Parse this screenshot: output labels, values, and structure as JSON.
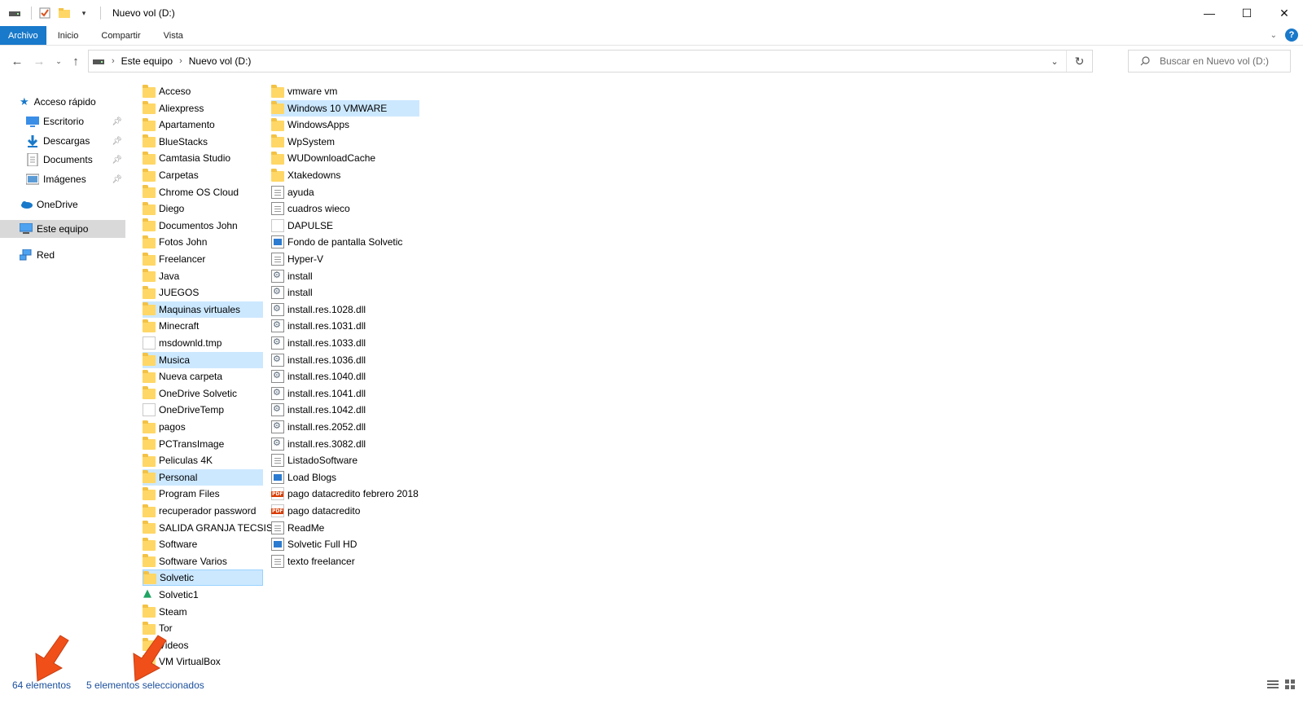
{
  "window": {
    "title": "Nuevo vol (D:)",
    "controls": {
      "minimize": "—",
      "maximize": "☐",
      "close": "✕"
    }
  },
  "ribbon": {
    "tabs": [
      "Archivo",
      "Inicio",
      "Compartir",
      "Vista"
    ],
    "help": "?"
  },
  "address": {
    "crumbs": [
      "Este equipo",
      "Nuevo vol (D:)"
    ],
    "search_placeholder": "Buscar en Nuevo vol (D:)"
  },
  "nav": {
    "quick_access": "Acceso rápido",
    "items": [
      {
        "label": "Escritorio",
        "icon": "desktop-icon",
        "pinned": true
      },
      {
        "label": "Descargas",
        "icon": "download-icon",
        "pinned": true
      },
      {
        "label": "Documents",
        "icon": "documents-icon",
        "pinned": true
      },
      {
        "label": "Imágenes",
        "icon": "pictures-icon",
        "pinned": true
      }
    ],
    "onedrive": "OneDrive",
    "this_pc": "Este equipo",
    "network": "Red"
  },
  "files": {
    "col1": [
      {
        "name": "Acceso",
        "type": "folder"
      },
      {
        "name": "Aliexpress",
        "type": "folder"
      },
      {
        "name": "Apartamento",
        "type": "folder"
      },
      {
        "name": "BlueStacks",
        "type": "folder"
      },
      {
        "name": "Camtasia Studio",
        "type": "folder"
      },
      {
        "name": "Carpetas",
        "type": "folder"
      },
      {
        "name": "Chrome OS Cloud",
        "type": "folder"
      },
      {
        "name": "Diego",
        "type": "folder"
      },
      {
        "name": "Documentos John",
        "type": "folder"
      },
      {
        "name": "Fotos John",
        "type": "folder"
      },
      {
        "name": "Freelancer",
        "type": "folder"
      },
      {
        "name": "Java",
        "type": "folder"
      },
      {
        "name": "JUEGOS",
        "type": "folder"
      },
      {
        "name": "Maquinas virtuales",
        "type": "folder",
        "selected": true
      },
      {
        "name": "Minecraft",
        "type": "folder"
      },
      {
        "name": "msdownld.tmp",
        "type": "blank"
      },
      {
        "name": "Musica",
        "type": "folder",
        "selected": true
      },
      {
        "name": "Nueva carpeta",
        "type": "folder"
      },
      {
        "name": "OneDrive Solvetic",
        "type": "folder"
      },
      {
        "name": "OneDriveTemp",
        "type": "blank"
      },
      {
        "name": "pagos",
        "type": "folder"
      },
      {
        "name": "PCTransImage",
        "type": "folder"
      },
      {
        "name": "Peliculas 4K",
        "type": "folder"
      },
      {
        "name": "Personal",
        "type": "folder",
        "selected": true
      },
      {
        "name": "Program Files",
        "type": "folder"
      },
      {
        "name": "recuperador password",
        "type": "folder"
      },
      {
        "name": "SALIDA GRANJA TECSIS",
        "type": "folder"
      },
      {
        "name": "Software",
        "type": "folder"
      },
      {
        "name": "Software Varios",
        "type": "folder"
      },
      {
        "name": "Solvetic",
        "type": "folder",
        "selected": true,
        "focused": true
      },
      {
        "name": "Solvetic1",
        "type": "gdrive"
      },
      {
        "name": "Steam",
        "type": "folder"
      },
      {
        "name": "Tor",
        "type": "folder"
      },
      {
        "name": "Videos",
        "type": "folder"
      },
      {
        "name": "VM VirtualBox",
        "type": "folder"
      }
    ],
    "col2": [
      {
        "name": "vmware vm",
        "type": "folder"
      },
      {
        "name": "Windows 10 VMWARE",
        "type": "folder",
        "selected": true
      },
      {
        "name": "WindowsApps",
        "type": "folder"
      },
      {
        "name": "WpSystem",
        "type": "folder"
      },
      {
        "name": "WUDownloadCache",
        "type": "folder"
      },
      {
        "name": "Xtakedowns",
        "type": "folder"
      },
      {
        "name": "ayuda",
        "type": "doc"
      },
      {
        "name": "cuadros wieco",
        "type": "doc"
      },
      {
        "name": "DAPULSE",
        "type": "blank"
      },
      {
        "name": "Fondo de pantalla Solvetic",
        "type": "img"
      },
      {
        "name": "Hyper-V",
        "type": "doc"
      },
      {
        "name": "install",
        "type": "dll"
      },
      {
        "name": "install",
        "type": "dll"
      },
      {
        "name": "install.res.1028.dll",
        "type": "dll"
      },
      {
        "name": "install.res.1031.dll",
        "type": "dll"
      },
      {
        "name": "install.res.1033.dll",
        "type": "dll"
      },
      {
        "name": "install.res.1036.dll",
        "type": "dll"
      },
      {
        "name": "install.res.1040.dll",
        "type": "dll"
      },
      {
        "name": "install.res.1041.dll",
        "type": "dll"
      },
      {
        "name": "install.res.1042.dll",
        "type": "dll"
      },
      {
        "name": "install.res.2052.dll",
        "type": "dll"
      },
      {
        "name": "install.res.3082.dll",
        "type": "dll"
      },
      {
        "name": "ListadoSoftware",
        "type": "doc"
      },
      {
        "name": "Load Blogs",
        "type": "img"
      },
      {
        "name": "pago datacredito febrero 2018",
        "type": "pdf"
      },
      {
        "name": "pago datacredito",
        "type": "pdf"
      },
      {
        "name": "ReadMe",
        "type": "doc"
      },
      {
        "name": "Solvetic Full HD",
        "type": "img"
      },
      {
        "name": "texto freelancer",
        "type": "doc"
      }
    ]
  },
  "status": {
    "count": "64 elementos",
    "selected": "5 elementos seleccionados"
  },
  "colors": {
    "accent": "#1979ca",
    "selection": "#cce8ff",
    "arrow": "#f04f1a"
  }
}
